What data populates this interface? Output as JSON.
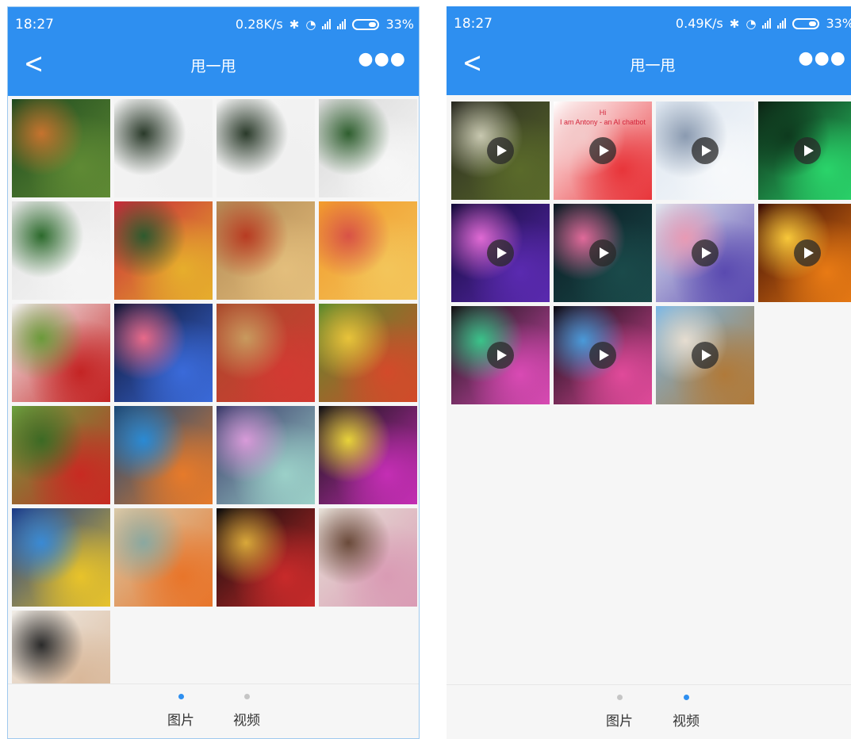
{
  "left": {
    "status": {
      "time": "18:27",
      "speed": "0.28K/s",
      "battery": "33%"
    },
    "title": "甩一甩",
    "tabs": [
      {
        "label": "图片",
        "active": true
      },
      {
        "label": "视频",
        "active": false
      }
    ],
    "thumbnails": [
      {
        "name": "photo-circuit-board",
        "colors": [
          "#1f4a1f",
          "#5f8a34",
          "#c6732e"
        ]
      },
      {
        "name": "photo-gps-antenna-module",
        "colors": [
          "#f4f4f4",
          "#f0f0f0",
          "#2a3a2a"
        ]
      },
      {
        "name": "photo-gps-antenna-module-2",
        "colors": [
          "#f4f4f4",
          "#f0f0f0",
          "#2a3a2a"
        ]
      },
      {
        "name": "photo-ec20-module",
        "colors": [
          "#d9d9d9",
          "#f7f7f7",
          "#2f5f2f"
        ]
      },
      {
        "name": "photo-uc20-module",
        "colors": [
          "#e4e4e4",
          "#f5f5f5",
          "#2c6a2c"
        ]
      },
      {
        "name": "photo-tulips",
        "colors": [
          "#c8283a",
          "#e6ae2c",
          "#2e5a2e"
        ]
      },
      {
        "name": "photo-fruit-basket",
        "colors": [
          "#b38a55",
          "#e3be7c",
          "#b83b22"
        ]
      },
      {
        "name": "photo-oranges-grapefruit",
        "colors": [
          "#f29a2c",
          "#f3c55a",
          "#d85246"
        ]
      },
      {
        "name": "photo-cherries-bowl",
        "colors": [
          "#f3f3f3",
          "#c42424",
          "#6b9a3a"
        ]
      },
      {
        "name": "photo-jellyfish",
        "colors": [
          "#0e1433",
          "#3a6ad9",
          "#e86a8a"
        ]
      },
      {
        "name": "photo-strawberries",
        "colors": [
          "#a94a2c",
          "#d23a32",
          "#c89a5e"
        ]
      },
      {
        "name": "photo-vegetables",
        "colors": [
          "#5a8a2c",
          "#d34a2a",
          "#e8c33a"
        ]
      },
      {
        "name": "photo-cherries-branch",
        "colors": [
          "#6aa03e",
          "#c82a22",
          "#3c6a24"
        ]
      },
      {
        "name": "photo-mandarin-fish",
        "colors": [
          "#1a4a7a",
          "#e67a2a",
          "#2a8ad4"
        ]
      },
      {
        "name": "photo-sea-anemone",
        "colors": [
          "#3a3a6a",
          "#9bd0c8",
          "#d89bd9"
        ]
      },
      {
        "name": "photo-bokeh-ball",
        "colors": [
          "#141414",
          "#c42eb4",
          "#e8d33a"
        ]
      },
      {
        "name": "photo-aquarium-fish",
        "colors": [
          "#1a3a8a",
          "#e8c32a",
          "#3a8ad4"
        ]
      },
      {
        "name": "photo-clownfish",
        "colors": [
          "#d9c9a8",
          "#e8752a",
          "#8aa8a0"
        ]
      },
      {
        "name": "photo-christmas-ornaments",
        "colors": [
          "#0c0c0c",
          "#c82a2a",
          "#d9a83a"
        ]
      },
      {
        "name": "photo-children-laptop",
        "colors": [
          "#e6e0d6",
          "#d99bb4",
          "#6a4a3a"
        ]
      },
      {
        "name": "photo-woman-earphones",
        "colors": [
          "#f0ece6",
          "#d9b89a",
          "#2a2a2a"
        ]
      }
    ]
  },
  "right": {
    "status": {
      "time": "18:27",
      "speed": "0.49K/s",
      "battery": "33%"
    },
    "title": "甩一甩",
    "tabs": [
      {
        "label": "图片",
        "active": false
      },
      {
        "label": "视频",
        "active": true
      }
    ],
    "thumbnails": [
      {
        "name": "video-bowl-still-life",
        "colors": [
          "#2a2a22",
          "#5a6a2a",
          "#c8c8b0"
        ]
      },
      {
        "name": "video-ai-chatbot",
        "colors": [
          "#ffffff",
          "#e8353a",
          "#f3c8c8"
        ],
        "text": [
          "Hi",
          "I am Antony - an AI chatbot"
        ]
      },
      {
        "name": "video-snow-landscape",
        "colors": [
          "#dde6f0",
          "#f7f9fb",
          "#8a9ab0"
        ]
      },
      {
        "name": "video-green-cross",
        "colors": [
          "#0c2214",
          "#2ad46a",
          "#0e3a1e"
        ]
      },
      {
        "name": "video-purple-particles",
        "colors": [
          "#140a3a",
          "#5a2ab0",
          "#e06ad4"
        ]
      },
      {
        "name": "video-lotus-pond",
        "colors": [
          "#0a1a22",
          "#1a4a4a",
          "#e06a9a"
        ]
      },
      {
        "name": "video-flowers-vase",
        "colors": [
          "#e0e6ee",
          "#5a4ab0",
          "#e89ab4"
        ]
      },
      {
        "name": "video-fire",
        "colors": [
          "#3a0a04",
          "#e87a14",
          "#f8c83a"
        ]
      },
      {
        "name": "video-kaleidoscope-ring",
        "colors": [
          "#141414",
          "#d94ab4",
          "#3ac48a"
        ]
      },
      {
        "name": "video-kaleidoscope-star",
        "colors": [
          "#0c0c14",
          "#e04a9a",
          "#4a9ad9"
        ]
      },
      {
        "name": "video-acorn-squirrel",
        "colors": [
          "#7ab8e6",
          "#b07a3a",
          "#e6ddd0"
        ]
      }
    ]
  }
}
